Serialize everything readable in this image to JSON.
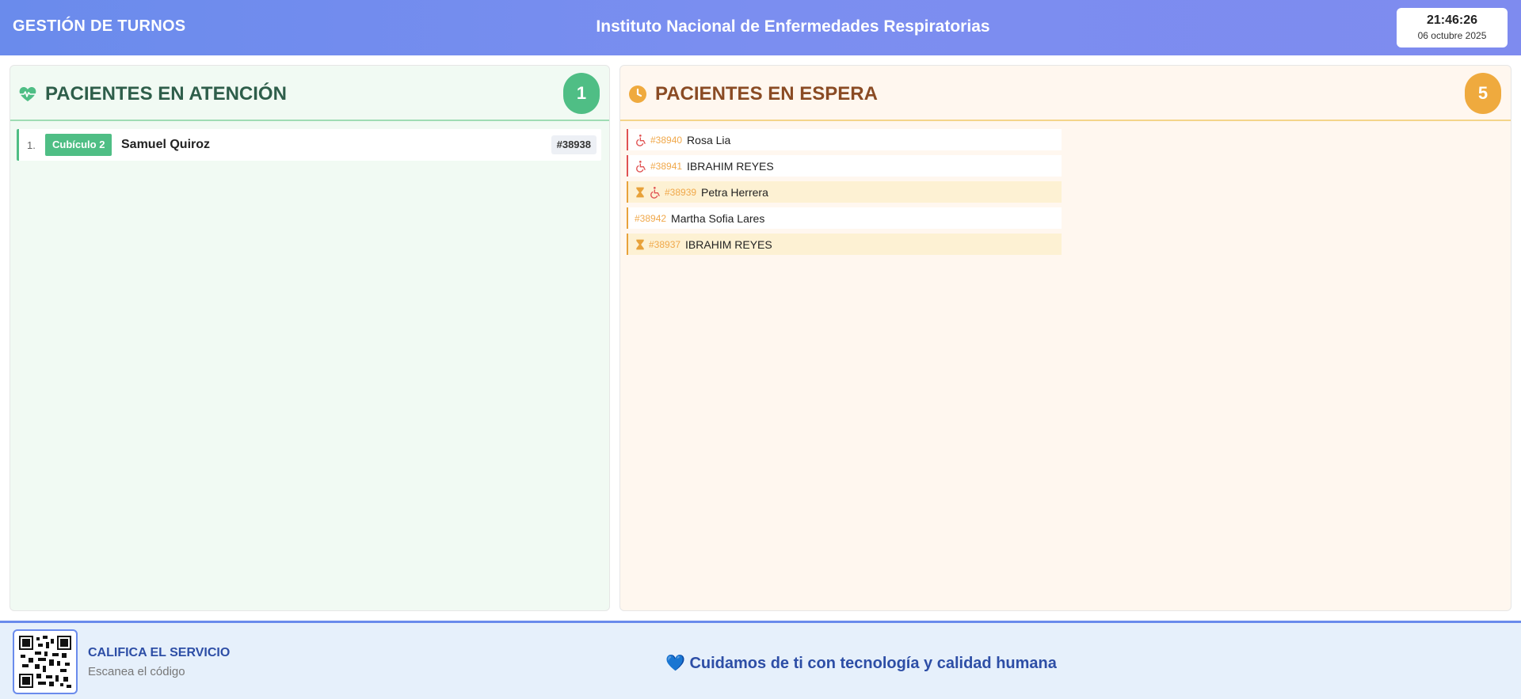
{
  "header": {
    "brand": "GESTIÓN DE TURNOS",
    "institute": "Instituto Nacional de Enfermedades Respiratorias",
    "time": "21:46:26",
    "date": "06 octubre 2025"
  },
  "attention": {
    "title": "PACIENTES EN ATENCIÓN",
    "count": "1",
    "icon": "heart-pulse-icon",
    "color": "#4fbe85",
    "patients": [
      {
        "num": "1.",
        "cubicle": "Cubículo 2",
        "name": "Samuel Quiroz",
        "ticket": "#38938"
      }
    ]
  },
  "waiting": {
    "title": "PACIENTES EN ESPERA",
    "count": "5",
    "icon": "clock-icon",
    "color": "#efaa3e",
    "patients": [
      {
        "ticket": "#38940",
        "name": "Rosa Lia",
        "priority": true,
        "delayed": false
      },
      {
        "ticket": "#38941",
        "name": "IBRAHIM REYES",
        "priority": true,
        "delayed": false
      },
      {
        "ticket": "#38939",
        "name": "Petra Herrera",
        "priority": true,
        "delayed": true
      },
      {
        "ticket": "#38942",
        "name": "Martha Sofia Lares",
        "priority": false,
        "delayed": false
      },
      {
        "ticket": "#38937",
        "name": "IBRAHIM REYES",
        "priority": false,
        "delayed": true
      }
    ]
  },
  "footer": {
    "rate_title": "CALIFICA EL SERVICIO",
    "rate_sub": "Escanea el código",
    "tagline": "💙 Cuidamos de ti con tecnología y calidad humana"
  },
  "colors": {
    "header": "#6a8bec",
    "priority": "#e05252",
    "ticket": "#f0a84a"
  }
}
